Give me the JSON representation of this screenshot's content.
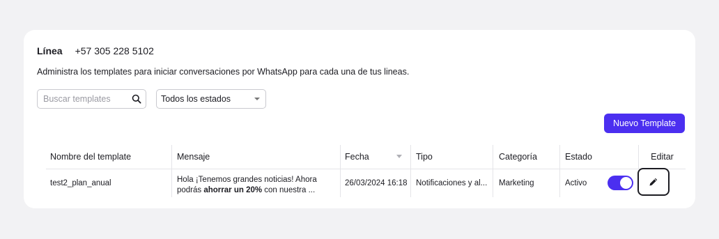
{
  "header": {
    "line_label": "Línea",
    "line_number": "+57 305 228 5102",
    "description": "Administra los templates para iniciar conversaciones por WhatsApp para cada una de tus lineas."
  },
  "search": {
    "placeholder": "Buscar templates",
    "value": "",
    "icon": "search-icon"
  },
  "status_filter": {
    "selected": "Todos los estados"
  },
  "new_button": {
    "label": "Nuevo Template"
  },
  "table": {
    "headers": {
      "name": "Nombre del template",
      "message": "Mensaje",
      "date": "Fecha",
      "type": "Tipo",
      "category": "Categoría",
      "status": "Estado",
      "edit": "Editar"
    },
    "rows": [
      {
        "name": "test2_plan_anual",
        "message_line1": "Hola ¡Tenemos grandes noticias! Ahora",
        "message_line2_pre": "podrás ",
        "message_line2_bold": "ahorrar un 20%",
        "message_line2_post": " con nuestra ...",
        "date": "26/03/2024 16:18",
        "type": "Notificaciones y al...",
        "category": "Marketing",
        "status": "Activo",
        "toggle_on": true
      }
    ]
  },
  "colors": {
    "accent": "#4b2ff0",
    "background": "#f2f2f4",
    "card": "#ffffff"
  }
}
